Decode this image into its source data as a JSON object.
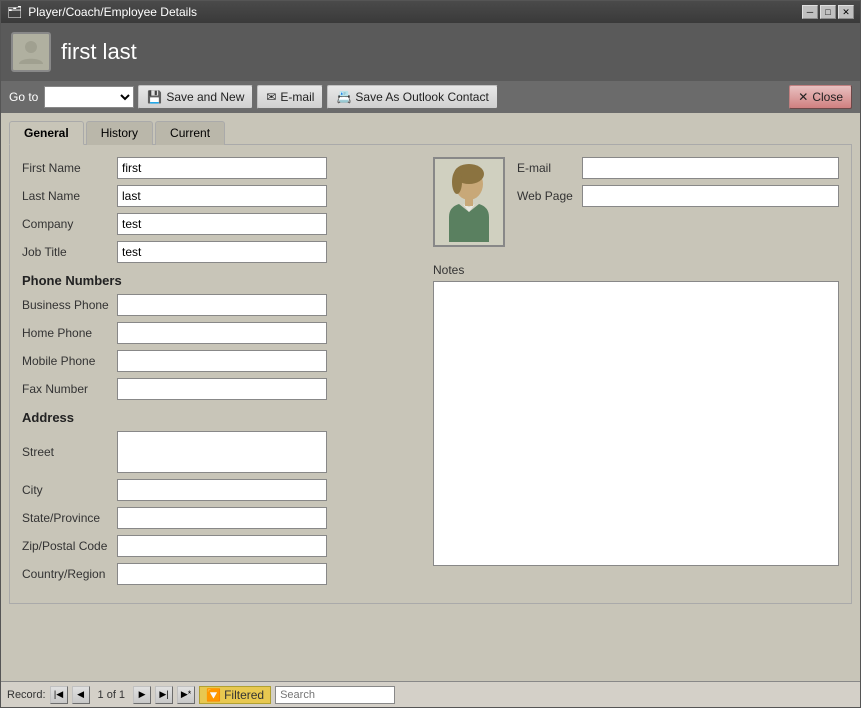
{
  "titlebar": {
    "title": "Player/Coach/Employee Details",
    "min_btn": "─",
    "max_btn": "□",
    "close_btn": "✕"
  },
  "header": {
    "title": "first last"
  },
  "toolbar": {
    "goto_label": "Go to",
    "goto_placeholder": "",
    "save_new_label": "Save and New",
    "email_label": "E-mail",
    "save_outlook_label": "Save As Outlook Contact",
    "close_label": "Close"
  },
  "tabs": [
    {
      "id": "general",
      "label": "General",
      "active": true
    },
    {
      "id": "history",
      "label": "History",
      "active": false
    },
    {
      "id": "current",
      "label": "Current",
      "active": false
    }
  ],
  "form": {
    "first_name_label": "First Name",
    "first_name_value": "first",
    "last_name_label": "Last Name",
    "last_name_value": "last",
    "company_label": "Company",
    "company_value": "test",
    "job_title_label": "Job Title",
    "job_title_value": "test",
    "phone_section": "Phone Numbers",
    "business_phone_label": "Business Phone",
    "business_phone_value": "",
    "home_phone_label": "Home Phone",
    "home_phone_value": "",
    "mobile_phone_label": "Mobile Phone",
    "mobile_phone_value": "",
    "fax_number_label": "Fax Number",
    "fax_number_value": "",
    "address_section": "Address",
    "street_label": "Street",
    "street_value": "",
    "city_label": "City",
    "city_value": "",
    "state_label": "State/Province",
    "state_value": "",
    "zip_label": "Zip/Postal Code",
    "zip_value": "",
    "country_label": "Country/Region",
    "country_value": "",
    "email_label": "E-mail",
    "email_value": "",
    "webpage_label": "Web Page",
    "webpage_value": "",
    "notes_label": "Notes"
  },
  "statusbar": {
    "record_label": "Record:",
    "record_nav_first": "◀◀",
    "record_nav_prev": "◀",
    "record_current": "1 of 1",
    "record_nav_next": "▶",
    "record_nav_last": "▶▶",
    "record_nav_new": "▶*",
    "filtered_label": "Filtered",
    "search_placeholder": "Search"
  }
}
